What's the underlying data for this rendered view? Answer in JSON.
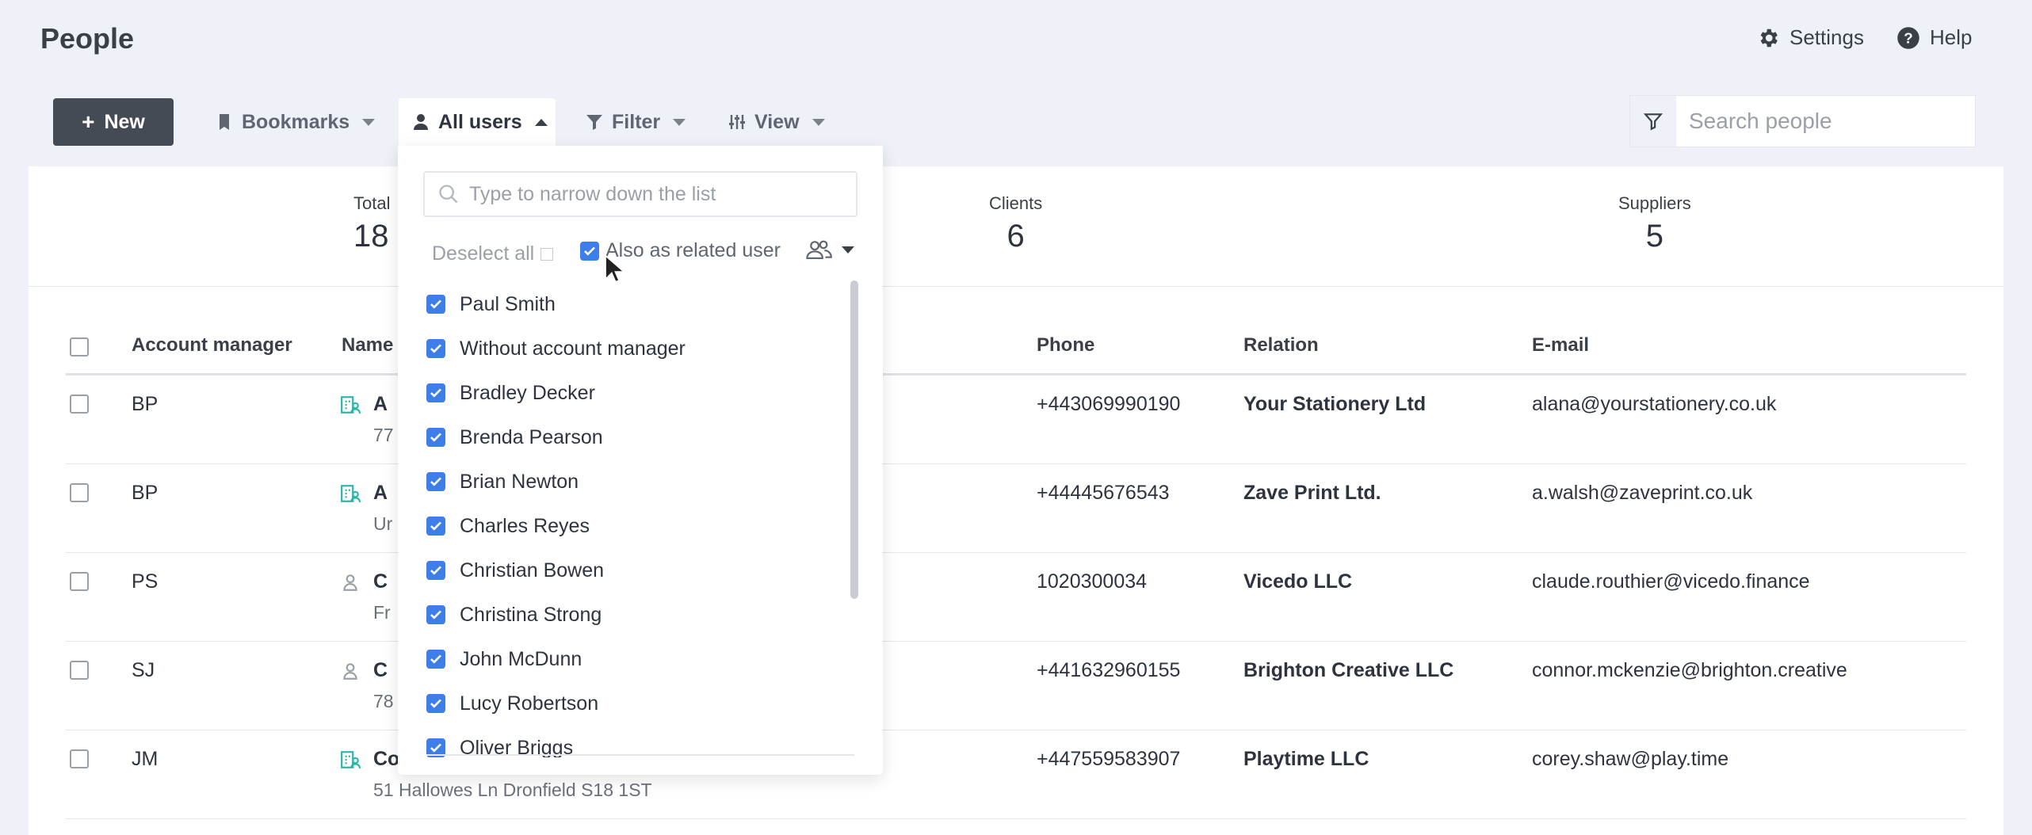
{
  "header": {
    "title": "People",
    "settings_label": "Settings",
    "help_label": "Help"
  },
  "toolbar": {
    "new_label": "New",
    "bookmarks_label": "Bookmarks",
    "all_users_label": "All users",
    "filter_label": "Filter",
    "view_label": "View",
    "search_placeholder": "Search people"
  },
  "stats": [
    {
      "label": "Total",
      "value": "18"
    },
    {
      "label": "Clients",
      "value": "6"
    },
    {
      "label": "Suppliers",
      "value": "5"
    }
  ],
  "table": {
    "headers": {
      "account_manager": "Account manager",
      "name": "Name",
      "phone": "Phone",
      "relation": "Relation",
      "email": "E-mail"
    },
    "rows": [
      {
        "manager": "BP",
        "name": "A",
        "address": "77",
        "phone": "+443069990190",
        "relation": "Your Stationery Ltd",
        "email": "alana@yourstationery.co.uk",
        "icon": "building-person-icon"
      },
      {
        "manager": "BP",
        "name": "A",
        "address": "Ur",
        "phone": "+44445676543",
        "relation": "Zave Print Ltd.",
        "email": "a.walsh@zaveprint.co.uk",
        "icon": "building-person-icon"
      },
      {
        "manager": "PS",
        "name": "C",
        "address": "Fr",
        "phone": "1020300034",
        "relation": "Vicedo LLC",
        "email": "claude.routhier@vicedo.finance",
        "icon": "person-icon"
      },
      {
        "manager": "SJ",
        "name": "C",
        "address": "78",
        "phone": "+441632960155",
        "relation": "Brighton Creative LLC",
        "email": "connor.mckenzie@brighton.creative",
        "icon": "person-icon"
      },
      {
        "manager": "JM",
        "name": "Corey Shaw",
        "address": "51 Hallowes Ln Dronfield S18 1ST",
        "phone": "+447559583907",
        "relation": "Playtime LLC",
        "email": "corey.shaw@play.time",
        "icon": "building-person-icon"
      }
    ]
  },
  "dropdown": {
    "search_placeholder": "Type to narrow down the list",
    "deselect_label": "Deselect all",
    "also_related_label": "Also as related user",
    "items": [
      "Paul Smith",
      "Without account manager",
      "Bradley Decker",
      "Brenda Pearson",
      "Brian Newton",
      "Charles Reyes",
      "Christian Bowen",
      "Christina Strong",
      "John McDunn",
      "Lucy Robertson",
      "Oliver Briggs"
    ]
  },
  "colors": {
    "accent": "#3d7ee8",
    "new_button": "#454b54",
    "background": "#eef1f7",
    "teal_icon": "#2bb5a8"
  }
}
